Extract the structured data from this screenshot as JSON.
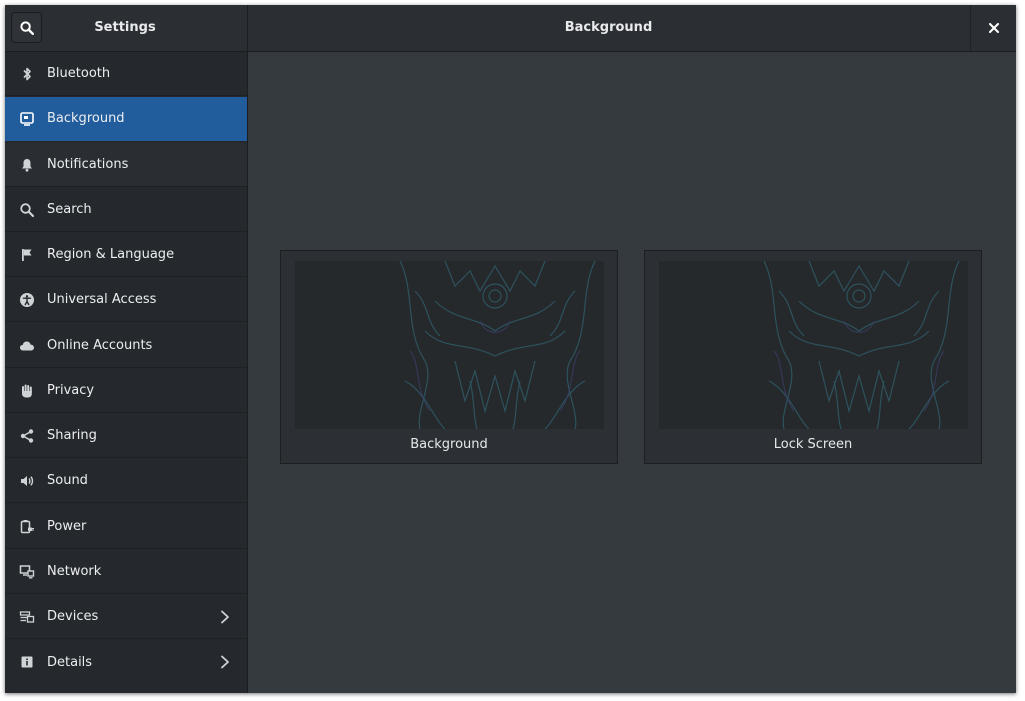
{
  "header": {
    "sidebar_title": "Settings",
    "page_title": "Background"
  },
  "sidebar": {
    "items": [
      {
        "label": "Bluetooth",
        "icon": "bluetooth-icon",
        "selected": false
      },
      {
        "label": "Background",
        "icon": "background-icon",
        "selected": true
      },
      {
        "label": "Notifications",
        "icon": "bell-icon",
        "selected": false
      },
      {
        "label": "Search",
        "icon": "search-icon",
        "selected": false
      },
      {
        "label": "Region & Language",
        "icon": "flag-icon",
        "selected": false
      },
      {
        "label": "Universal Access",
        "icon": "accessibility-icon",
        "selected": false
      },
      {
        "label": "Online Accounts",
        "icon": "cloud-icon",
        "selected": false
      },
      {
        "label": "Privacy",
        "icon": "hand-icon",
        "selected": false
      },
      {
        "label": "Sharing",
        "icon": "share-icon",
        "selected": false
      },
      {
        "label": "Sound",
        "icon": "speaker-icon",
        "selected": false
      },
      {
        "label": "Power",
        "icon": "power-plug-icon",
        "selected": false
      },
      {
        "label": "Network",
        "icon": "network-icon",
        "selected": false
      },
      {
        "label": "Devices",
        "icon": "devices-icon",
        "selected": false,
        "has_submenu": true
      },
      {
        "label": "Details",
        "icon": "info-icon",
        "selected": false,
        "has_submenu": true
      }
    ]
  },
  "main": {
    "previews": [
      {
        "label": "Background"
      },
      {
        "label": "Lock Screen"
      }
    ]
  },
  "colors": {
    "accent": "#215d9c",
    "sidebar_bg": "#25292d",
    "content_bg": "#353a3f",
    "headerbar_bg": "#2b2f33",
    "wallpaper_art": "#2f5560"
  }
}
